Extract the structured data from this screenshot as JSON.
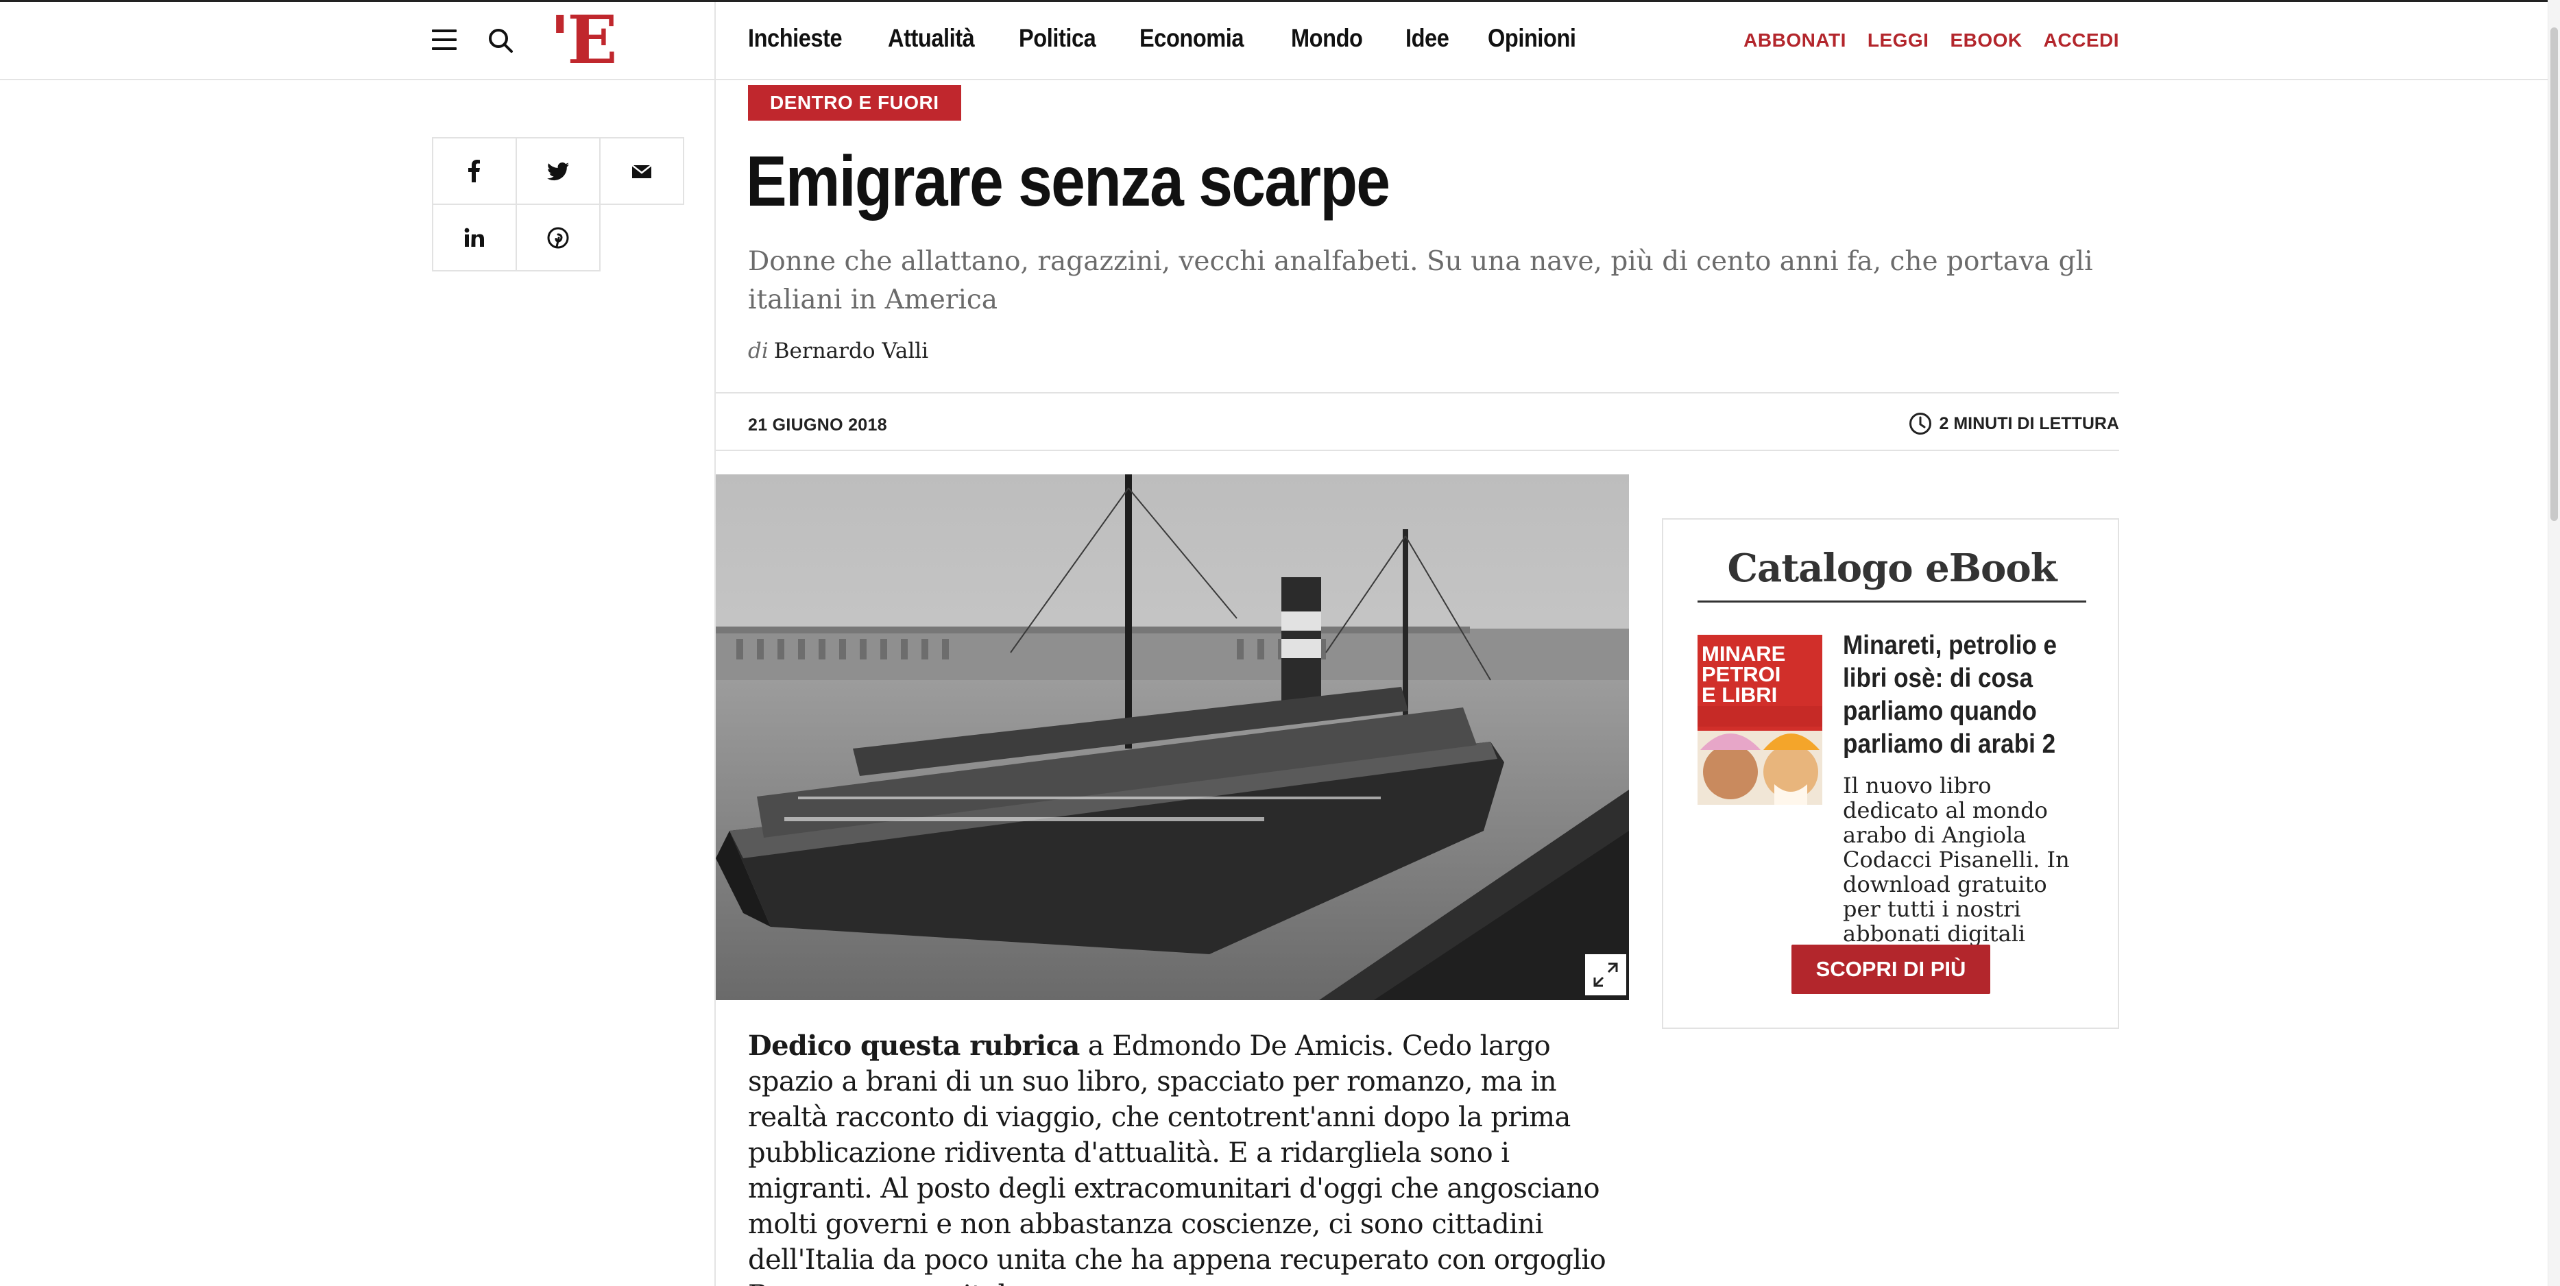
{
  "header": {
    "logo_text": "'E",
    "nav": [
      "Inchieste",
      "Attualità",
      "Politica",
      "Economia",
      "Mondo",
      "Idee",
      "Opinioni"
    ],
    "user_links": [
      "ABBONATI",
      "LEGGI",
      "EBOOK",
      "ACCEDI"
    ]
  },
  "share": {
    "icons": [
      "facebook-icon",
      "twitter-icon",
      "email-icon",
      "linkedin-icon",
      "pinterest-icon"
    ]
  },
  "article": {
    "kicker": "DENTRO E FUORI",
    "title": "Emigrare senza scarpe",
    "subtitle": "Donne che allattano, ragazzini, vecchi analfabeti. Su una nave, più di cento anni fa, che portava gli italiani in America",
    "byline_prefix": "di",
    "author": "Bernardo Valli",
    "date": "21 GIUGNO 2018",
    "read_time": "2 MINUTI DI LETTURA",
    "body_lead": "Dedico questa rubrica",
    "body_rest": " a Edmondo De Amicis. Cedo largo spazio a brani di un suo libro, spacciato per romanzo, ma in realtà racconto di viaggio, che centotrent'anni dopo la prima pubblicazione ridiventa d'attualità. E a ridargliela sono i migranti. Al posto degli extracomunitari d'oggi che angosciano molti governi e non abbastanza coscienze, ci sono cittadini dell'Italia da poco unita che ha appena recuperato con orgoglio Roma come capitale."
  },
  "ebook": {
    "heading": "Catalogo eBook",
    "cover_text": "MINARE PETROI E LIBRI",
    "book_title": "Minareti, petrolio e libri osè: di cosa parliamo quando parliamo di arabi 2",
    "description": "Il nuovo libro dedicato al mondo arabo di Angiola Codacci Pisanelli. In download gratuito per tutti i nostri abbonati digitali",
    "cta": "SCOPRI DI PIÙ"
  },
  "colors": {
    "brand_red": "#c0272d",
    "link_red": "#b3262c",
    "text": "#111111",
    "muted": "#6b6b6b"
  }
}
